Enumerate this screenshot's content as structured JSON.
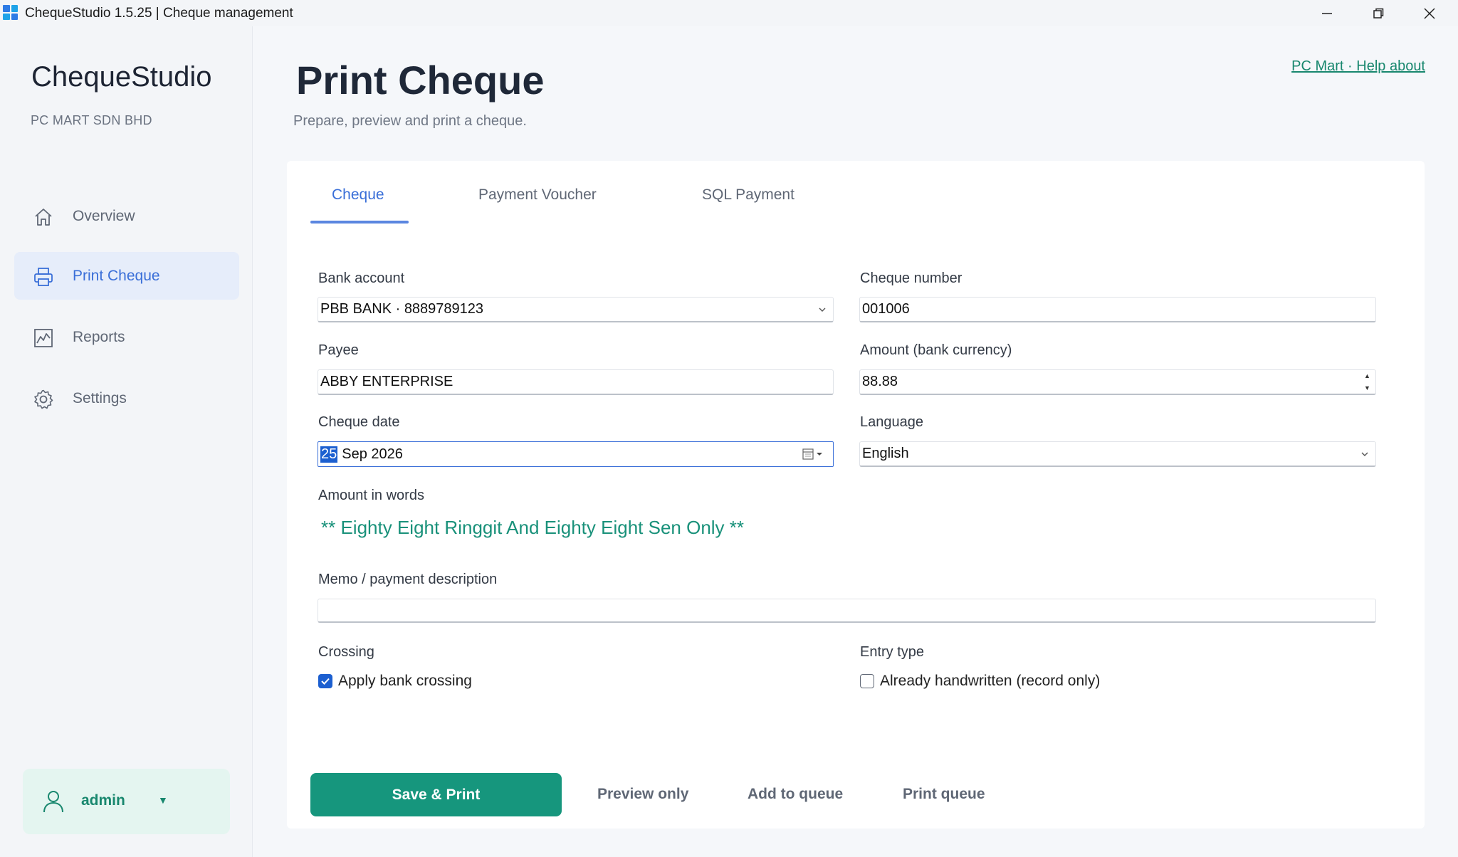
{
  "window": {
    "title": "ChequeStudio 1.5.25 | Cheque management",
    "icon_colors": [
      "#2d7be5",
      "#1fa3e8",
      "#1fa3e8",
      "#2d7be5"
    ]
  },
  "sidebar": {
    "brand": "ChequeStudio",
    "company": "PC MART SDN BHD",
    "items": [
      {
        "label": "Overview",
        "icon": "home-icon",
        "active": false
      },
      {
        "label": "Print Cheque",
        "icon": "printer-icon",
        "active": true
      },
      {
        "label": "Reports",
        "icon": "chart-icon",
        "active": false
      },
      {
        "label": "Settings",
        "icon": "gear-icon",
        "active": false
      }
    ],
    "user": {
      "name": "admin",
      "caret": "▼"
    }
  },
  "header": {
    "title": "Print Cheque",
    "subtitle": "Prepare, preview and print a cheque.",
    "help_link": "PC Mart · Help  about"
  },
  "tabs": [
    {
      "label": "Cheque",
      "active": true
    },
    {
      "label": "Payment Voucher",
      "active": false
    },
    {
      "label": "SQL Payment",
      "active": false
    }
  ],
  "form": {
    "bank_account": {
      "label": "Bank account",
      "value": "PBB BANK · 8889789123"
    },
    "cheque_number": {
      "label": "Cheque number",
      "value": "001006"
    },
    "payee": {
      "label": "Payee",
      "value": "ABBY ENTERPRISE"
    },
    "amount": {
      "label": "Amount (bank currency)",
      "value": "88.88"
    },
    "cheque_date": {
      "label": "Cheque date",
      "day": "25",
      "rest": "Sep  2026"
    },
    "language": {
      "label": "Language",
      "value": "English"
    },
    "amount_words": {
      "label": "Amount in words",
      "value": "** Eighty Eight Ringgit And Eighty Eight Sen Only **"
    },
    "memo": {
      "label": "Memo / payment description",
      "value": ""
    },
    "crossing": {
      "label": "Crossing",
      "option": "Apply bank crossing",
      "checked": true
    },
    "entry_type": {
      "label": "Entry type",
      "option": "Already handwritten (record only)",
      "checked": false
    }
  },
  "actions": {
    "save_print": "Save & Print",
    "preview": "Preview only",
    "add_queue": "Add to queue",
    "print_queue": "Print queue"
  },
  "colors": {
    "accent": "#3a6fd8",
    "brand_green": "#16967d",
    "active_nav_bg": "#e6edfa"
  }
}
